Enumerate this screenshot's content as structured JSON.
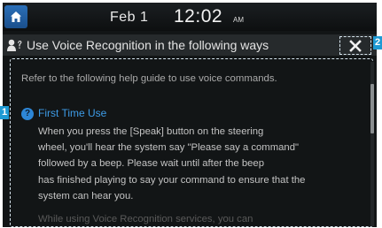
{
  "status_bar": {
    "date": "Feb  1",
    "time": "12:02",
    "ampm": "AM"
  },
  "title_bar": {
    "title": "Use Voice Recognition in the following ways",
    "close_icon": "close-icon"
  },
  "help": {
    "intro": "Refer to the following help guide to use voice commands.",
    "section_title": "First Time Use",
    "paragraph_lines": [
      "When you press the [Speak] button on the steering",
      "wheel, you'll hear the system say \"Please say a command\"",
      "followed by a beep. Please wait until after the beep",
      "has finished playing to say your command to ensure that the",
      "system can hear you."
    ],
    "faded_line": "While using Voice Recognition services, you can"
  },
  "callouts": [
    "1",
    "2"
  ],
  "colors": {
    "accent_blue": "#1e9ad4",
    "section_title": "#3d9be6",
    "background": "#121516"
  }
}
